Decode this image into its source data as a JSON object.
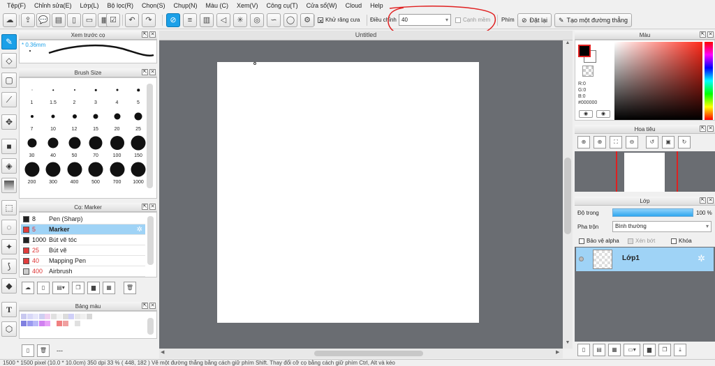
{
  "menu": [
    "Tệp(F)",
    "Chỉnh sửa(E)",
    "Lớp(L)",
    "Bộ lọc(R)",
    "Chọn(S)",
    "Chụp(N)",
    "Màu (C)",
    "Xem(V)",
    "Công cụ(T)",
    "Cửa sổ(W)",
    "Cloud",
    "Help"
  ],
  "toolbar": {
    "antialias_label": "Khử răng cưa",
    "adjust_label": "Điều chỉnh",
    "adjust_value": "40",
    "snap_label": "Cạnh mềm",
    "key_label": "Phím",
    "reset_label": "Đặt lại",
    "straight_line_label": "Tạo một đường thẳng"
  },
  "preview": {
    "title": "Xem trước cọ",
    "size_label": "* 0.36mm"
  },
  "brush_size": {
    "title": "Brush Size",
    "sizes": [
      "1",
      "1.5",
      "2",
      "3",
      "4",
      "5",
      "7",
      "10",
      "12",
      "15",
      "20",
      "25",
      "30",
      "40",
      "50",
      "70",
      "100",
      "150",
      "200",
      "300",
      "400",
      "500",
      "700",
      "1000"
    ]
  },
  "brush_list": {
    "title": "Cọ: Marker",
    "items": [
      {
        "size": "8",
        "name": "Pen (Sharp)",
        "color": "#222222"
      },
      {
        "size": "5",
        "name": "Marker",
        "color": "#e03c3c"
      },
      {
        "size": "1000",
        "name": "Bút vẽ tóc",
        "color": "#222222"
      },
      {
        "size": "25",
        "name": "Bút vẽ",
        "color": "#e03c3c"
      },
      {
        "size": "40",
        "name": "Mapping Pen",
        "color": "#e03c3c"
      },
      {
        "size": "400",
        "name": "Airbrush",
        "color": "#cccccc"
      }
    ]
  },
  "palette": {
    "title": "Bảng màu",
    "footer": "---"
  },
  "canvas": {
    "tab_title": "Untitled"
  },
  "color": {
    "title": "Màu",
    "r": "R:0",
    "g": "G:0",
    "b": "B:0",
    "hex": "#000000"
  },
  "navigator": {
    "title": "Hoa tiêu"
  },
  "layers": {
    "title": "Lớp",
    "opacity_label": "Độ trong",
    "opacity_value": "100 %",
    "blend_label": "Pha trộn",
    "blend_value": "Bình thường",
    "protect_alpha": "Bảo vệ alpha",
    "clipping": "Xén bớt",
    "lock": "Khóa",
    "layer_name": "Lớp1"
  },
  "status": "1500 * 1500 pixel  (10.0 * 10.0cm)  350 dpi  33 %  ( 448, 182 )  Vẽ một đường thẳng bằng cách giữ phím Shift. Thay đổi cỡ cọ bằng cách giữ phím Ctrl, Alt và kéo",
  "colors": {
    "accent": "#1ba0e8",
    "annotation": "#e02020",
    "workspace": "#6a6d72"
  }
}
